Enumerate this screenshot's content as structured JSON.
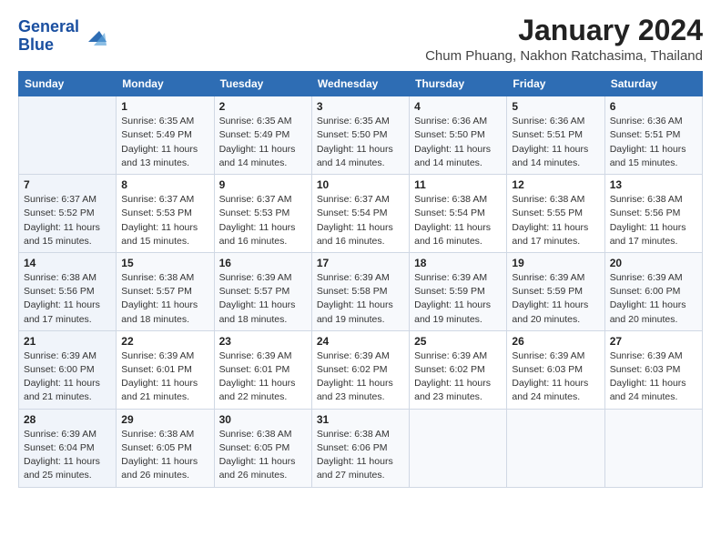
{
  "logo": {
    "line1": "General",
    "line2": "Blue"
  },
  "title": "January 2024",
  "subtitle": "Chum Phuang, Nakhon Ratchasima, Thailand",
  "days_of_week": [
    "Sunday",
    "Monday",
    "Tuesday",
    "Wednesday",
    "Thursday",
    "Friday",
    "Saturday"
  ],
  "weeks": [
    [
      {
        "day": "",
        "info": ""
      },
      {
        "day": "1",
        "info": "Sunrise: 6:35 AM\nSunset: 5:49 PM\nDaylight: 11 hours\nand 13 minutes."
      },
      {
        "day": "2",
        "info": "Sunrise: 6:35 AM\nSunset: 5:49 PM\nDaylight: 11 hours\nand 14 minutes."
      },
      {
        "day": "3",
        "info": "Sunrise: 6:35 AM\nSunset: 5:50 PM\nDaylight: 11 hours\nand 14 minutes."
      },
      {
        "day": "4",
        "info": "Sunrise: 6:36 AM\nSunset: 5:50 PM\nDaylight: 11 hours\nand 14 minutes."
      },
      {
        "day": "5",
        "info": "Sunrise: 6:36 AM\nSunset: 5:51 PM\nDaylight: 11 hours\nand 14 minutes."
      },
      {
        "day": "6",
        "info": "Sunrise: 6:36 AM\nSunset: 5:51 PM\nDaylight: 11 hours\nand 15 minutes."
      }
    ],
    [
      {
        "day": "7",
        "info": "Sunrise: 6:37 AM\nSunset: 5:52 PM\nDaylight: 11 hours\nand 15 minutes."
      },
      {
        "day": "8",
        "info": "Sunrise: 6:37 AM\nSunset: 5:53 PM\nDaylight: 11 hours\nand 15 minutes."
      },
      {
        "day": "9",
        "info": "Sunrise: 6:37 AM\nSunset: 5:53 PM\nDaylight: 11 hours\nand 16 minutes."
      },
      {
        "day": "10",
        "info": "Sunrise: 6:37 AM\nSunset: 5:54 PM\nDaylight: 11 hours\nand 16 minutes."
      },
      {
        "day": "11",
        "info": "Sunrise: 6:38 AM\nSunset: 5:54 PM\nDaylight: 11 hours\nand 16 minutes."
      },
      {
        "day": "12",
        "info": "Sunrise: 6:38 AM\nSunset: 5:55 PM\nDaylight: 11 hours\nand 17 minutes."
      },
      {
        "day": "13",
        "info": "Sunrise: 6:38 AM\nSunset: 5:56 PM\nDaylight: 11 hours\nand 17 minutes."
      }
    ],
    [
      {
        "day": "14",
        "info": "Sunrise: 6:38 AM\nSunset: 5:56 PM\nDaylight: 11 hours\nand 17 minutes."
      },
      {
        "day": "15",
        "info": "Sunrise: 6:38 AM\nSunset: 5:57 PM\nDaylight: 11 hours\nand 18 minutes."
      },
      {
        "day": "16",
        "info": "Sunrise: 6:39 AM\nSunset: 5:57 PM\nDaylight: 11 hours\nand 18 minutes."
      },
      {
        "day": "17",
        "info": "Sunrise: 6:39 AM\nSunset: 5:58 PM\nDaylight: 11 hours\nand 19 minutes."
      },
      {
        "day": "18",
        "info": "Sunrise: 6:39 AM\nSunset: 5:59 PM\nDaylight: 11 hours\nand 19 minutes."
      },
      {
        "day": "19",
        "info": "Sunrise: 6:39 AM\nSunset: 5:59 PM\nDaylight: 11 hours\nand 20 minutes."
      },
      {
        "day": "20",
        "info": "Sunrise: 6:39 AM\nSunset: 6:00 PM\nDaylight: 11 hours\nand 20 minutes."
      }
    ],
    [
      {
        "day": "21",
        "info": "Sunrise: 6:39 AM\nSunset: 6:00 PM\nDaylight: 11 hours\nand 21 minutes."
      },
      {
        "day": "22",
        "info": "Sunrise: 6:39 AM\nSunset: 6:01 PM\nDaylight: 11 hours\nand 21 minutes."
      },
      {
        "day": "23",
        "info": "Sunrise: 6:39 AM\nSunset: 6:01 PM\nDaylight: 11 hours\nand 22 minutes."
      },
      {
        "day": "24",
        "info": "Sunrise: 6:39 AM\nSunset: 6:02 PM\nDaylight: 11 hours\nand 23 minutes."
      },
      {
        "day": "25",
        "info": "Sunrise: 6:39 AM\nSunset: 6:02 PM\nDaylight: 11 hours\nand 23 minutes."
      },
      {
        "day": "26",
        "info": "Sunrise: 6:39 AM\nSunset: 6:03 PM\nDaylight: 11 hours\nand 24 minutes."
      },
      {
        "day": "27",
        "info": "Sunrise: 6:39 AM\nSunset: 6:03 PM\nDaylight: 11 hours\nand 24 minutes."
      }
    ],
    [
      {
        "day": "28",
        "info": "Sunrise: 6:39 AM\nSunset: 6:04 PM\nDaylight: 11 hours\nand 25 minutes."
      },
      {
        "day": "29",
        "info": "Sunrise: 6:38 AM\nSunset: 6:05 PM\nDaylight: 11 hours\nand 26 minutes."
      },
      {
        "day": "30",
        "info": "Sunrise: 6:38 AM\nSunset: 6:05 PM\nDaylight: 11 hours\nand 26 minutes."
      },
      {
        "day": "31",
        "info": "Sunrise: 6:38 AM\nSunset: 6:06 PM\nDaylight: 11 hours\nand 27 minutes."
      },
      {
        "day": "",
        "info": ""
      },
      {
        "day": "",
        "info": ""
      },
      {
        "day": "",
        "info": ""
      }
    ]
  ]
}
